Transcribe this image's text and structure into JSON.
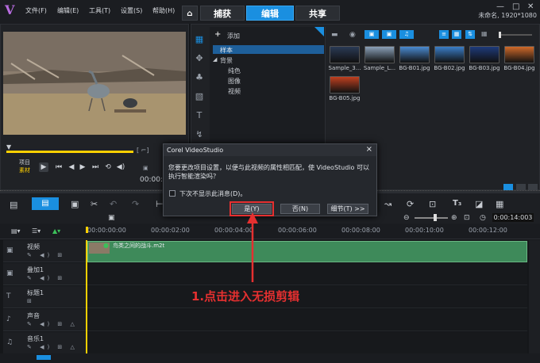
{
  "titlebar": {
    "menus": [
      "文件(F)",
      "编辑(E)",
      "工具(T)",
      "设置(S)",
      "帮助(H)"
    ],
    "tabs": {
      "home": "⌂",
      "capture": "捕获",
      "edit": "编辑",
      "share": "共享"
    },
    "project_info": "未命名, 1920*1080"
  },
  "library": {
    "add_label": "添加",
    "tree": {
      "root": "样本",
      "bg": "背景",
      "solid": "纯色",
      "image": "图像",
      "video": "视频"
    },
    "thumbs": [
      {
        "label": "Sample_3...",
        "color": "#2a3a55"
      },
      {
        "label": "Sample_L...",
        "color": "#8aa0b8"
      },
      {
        "label": "BG-B01.jpg",
        "color": "#4a8ad0"
      },
      {
        "label": "BG-B02.jpg",
        "color": "#3a7ec8"
      },
      {
        "label": "BG-B03.jpg",
        "color": "#1e3a7a"
      },
      {
        "label": "BG-B04.jpg",
        "color": "#d06a2a"
      },
      {
        "label": "BG-B05.jpg",
        "color": "#c04020"
      }
    ]
  },
  "player": {
    "project_label": "项目",
    "clip_label": "素材",
    "timecode": "00:00:"
  },
  "timeline": {
    "timecode": "0:00:14:003",
    "ruler": [
      "00:00:00:00",
      "00:00:02:00",
      "00:00:04:00",
      "00:00:06:00",
      "00:00:08:00",
      "00:00:10:00",
      "00:00:12:00"
    ],
    "tracks": [
      {
        "name": "视频",
        "icon": "▣"
      },
      {
        "name": "叠加1",
        "icon": "▣"
      },
      {
        "name": "标题1",
        "icon": "T"
      },
      {
        "name": "声音",
        "icon": "♪"
      },
      {
        "name": "音乐1",
        "icon": "♫"
      }
    ],
    "clip_name": "鸟类之间的战斗.m2t"
  },
  "dialog": {
    "title": "Corel VideoStudio",
    "close": "×",
    "message": "您要更改项目设置，以便与此视频的属性相匹配，使 VideoStudio 可以执行智能渲染吗？",
    "checkbox_label": "下次不显示此消息(D)。",
    "yes": "是(Y)",
    "no": "否(N)",
    "details": "细节(T) >>"
  },
  "annotation": "1.点击进入无损剪辑",
  "colors": {
    "accent": "#1a8fe0",
    "annotation": "#e53030",
    "clip": "#3e8a5a"
  }
}
